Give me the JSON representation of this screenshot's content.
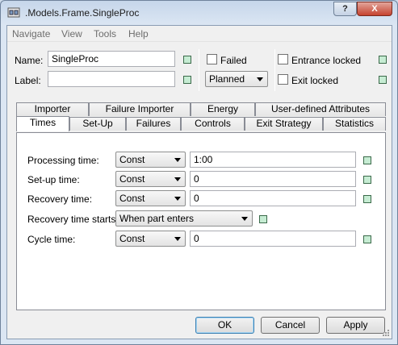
{
  "window": {
    "title": ".Models.Frame.SingleProc"
  },
  "titlebar_buttons": {
    "help": "?",
    "close": "X"
  },
  "menu": [
    "Navigate",
    "View",
    "Tools",
    "Help"
  ],
  "header": {
    "name_label": "Name:",
    "name_value": "SingleProc",
    "label_label": "Label:",
    "label_value": "",
    "failed_label": "Failed",
    "failed_checked": false,
    "status_value": "Planned",
    "entrance_locked_label": "Entrance locked",
    "entrance_locked_checked": false,
    "exit_locked_label": "Exit locked",
    "exit_locked_checked": false
  },
  "tabs_row1": [
    "Importer",
    "Failure Importer",
    "Energy",
    "User-defined Attributes"
  ],
  "tabs_row2": [
    "Times",
    "Set-Up",
    "Failures",
    "Controls",
    "Exit Strategy",
    "Statistics"
  ],
  "active_tab": "Times",
  "times": {
    "processing": {
      "label": "Processing time:",
      "type": "Const",
      "value": "1:00"
    },
    "setup": {
      "label": "Set-up time:",
      "type": "Const",
      "value": "0"
    },
    "recovery": {
      "label": "Recovery time:",
      "type": "Const",
      "value": "0"
    },
    "recovery_starts": {
      "label": "Recovery time starts:",
      "value": "When part enters"
    },
    "cycle": {
      "label": "Cycle time:",
      "type": "Const",
      "value": "0"
    }
  },
  "buttons": {
    "ok": "OK",
    "cancel": "Cancel",
    "apply": "Apply"
  },
  "colors": {
    "indicator_fill": "#c6ecd3",
    "titlebar": "#c6d6ea",
    "close_button": "#c5432f"
  }
}
